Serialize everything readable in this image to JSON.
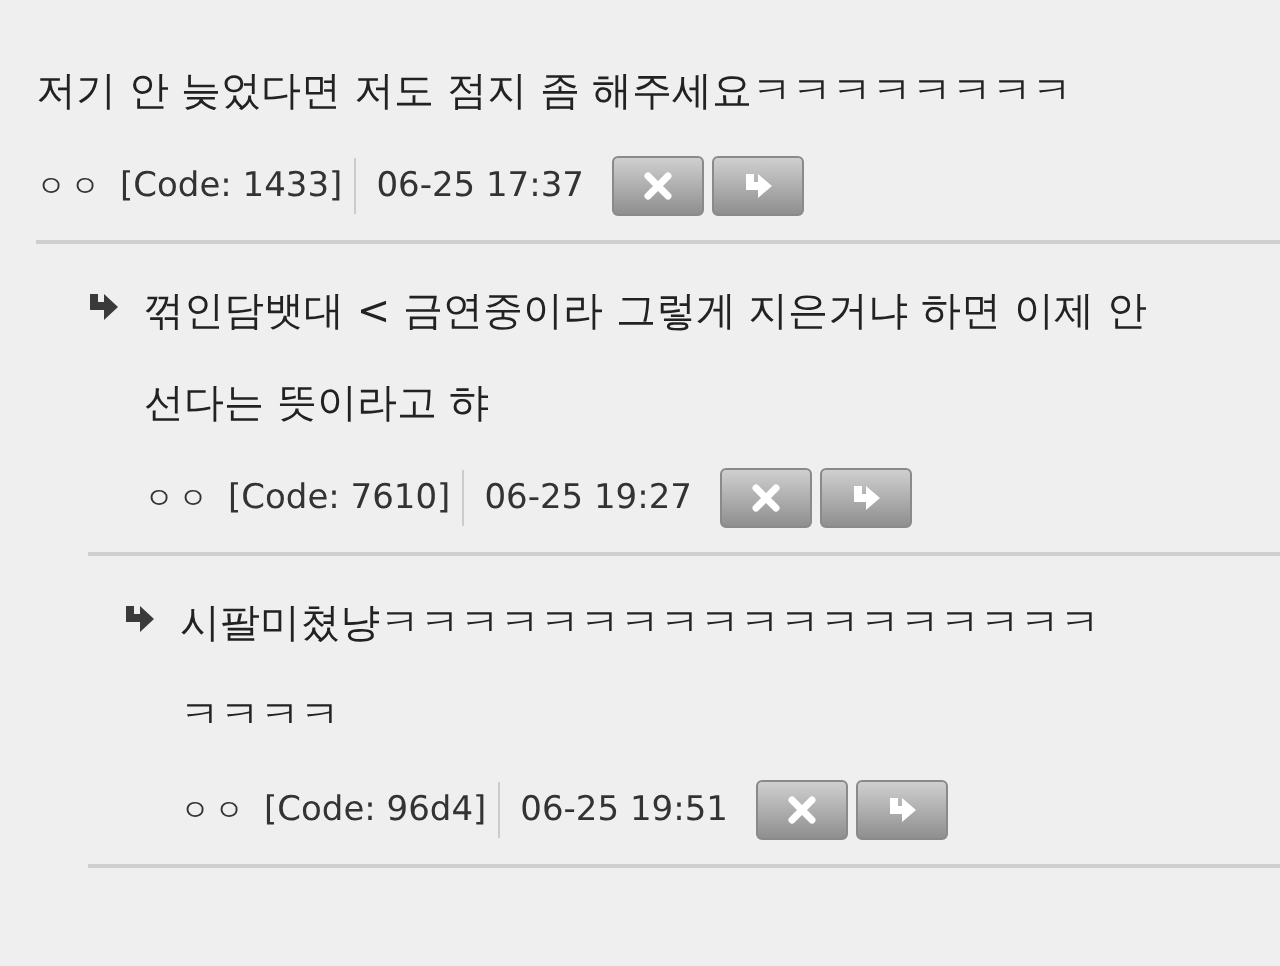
{
  "comments": [
    {
      "text": "저기 안 늦었다면 저도 점지 좀 해주세요ㅋㅋㅋㅋㅋㅋㅋㅋ",
      "author": "ㅇㅇ",
      "code": "[Code: 1433]",
      "datetime": "06-25 17:37",
      "children": [
        {
          "text": "꺾인담뱃대 < 금연중이라 그렇게 지은거냐 하면 이제 안선다는 뜻이라고 햐",
          "author": "ㅇㅇ",
          "code": "[Code: 7610]",
          "datetime": "06-25 19:27",
          "children": [
            {
              "text": "시팔미쳤냥ㅋㅋㅋㅋㅋㅋㅋㅋㅋㅋㅋㅋㅋㅋㅋㅋㅋㅋㅋㅋㅋㅋ",
              "author": "ㅇㅇ",
              "code": "[Code: 96d4]",
              "datetime": "06-25 19:51"
            }
          ]
        }
      ]
    }
  ]
}
